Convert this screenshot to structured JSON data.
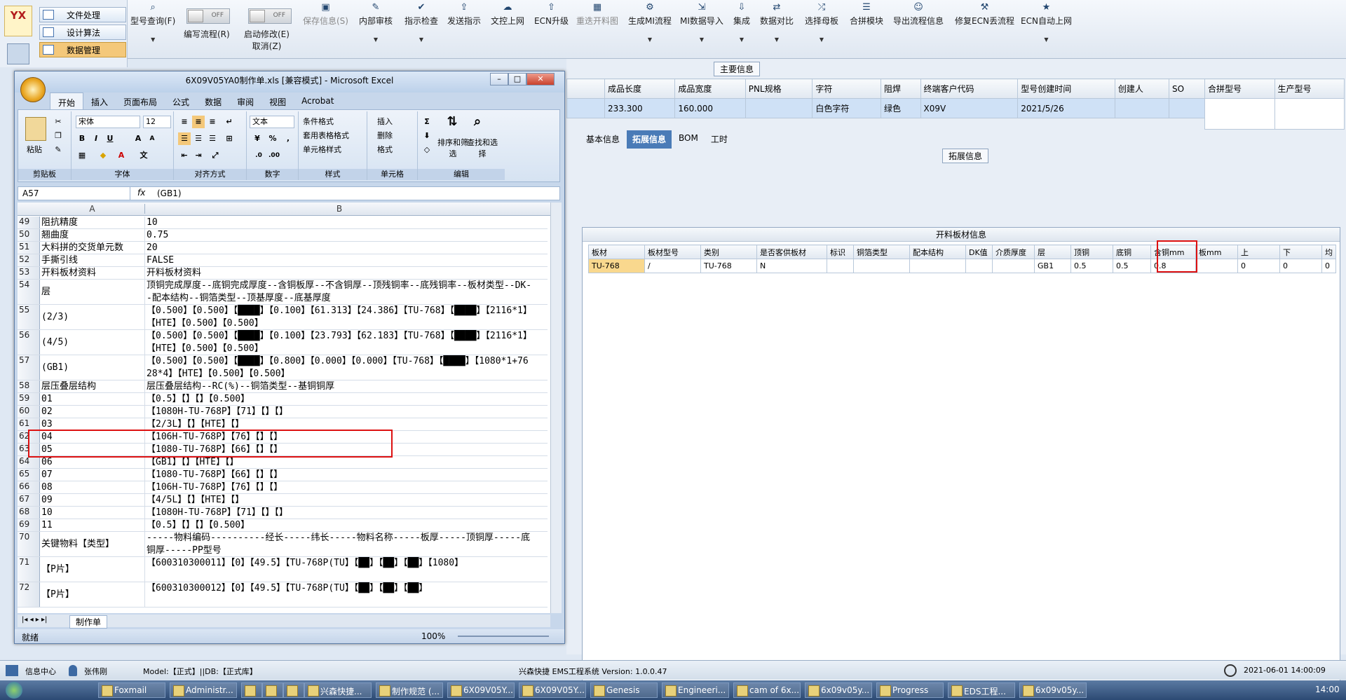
{
  "left_nav": {
    "logo": "YX",
    "items": [
      "文件处理",
      "设计算法",
      "数据管理"
    ]
  },
  "toolbar": {
    "buttons": [
      {
        "label": "型号查询(F)",
        "sub": "",
        "dis": false
      },
      {
        "label": "编写流程(R)",
        "sub": "",
        "dis": false
      },
      {
        "label": "启动修改(E)",
        "sub": "取消(Z)",
        "dis": false
      },
      {
        "label": "保存信息(S)",
        "sub": "",
        "dis": true
      },
      {
        "label": "内部审核",
        "sub": "",
        "dis": false
      },
      {
        "label": "指示检查",
        "sub": "",
        "dis": false
      },
      {
        "label": "发送指示",
        "sub": "",
        "dis": false
      },
      {
        "label": "文控上网",
        "sub": "",
        "dis": false
      },
      {
        "label": "ECN升级",
        "sub": "",
        "dis": false
      },
      {
        "label": "重迭开料图",
        "sub": "",
        "dis": true
      },
      {
        "label": "生成MI流程",
        "sub": "",
        "dis": false
      },
      {
        "label": "MI数据导入",
        "sub": "",
        "dis": false
      },
      {
        "label": "集成",
        "sub": "",
        "dis": false
      },
      {
        "label": "数据对比",
        "sub": "",
        "dis": false
      },
      {
        "label": "选择母板",
        "sub": "",
        "dis": false
      },
      {
        "label": "合拼模块",
        "sub": "",
        "dis": false
      },
      {
        "label": "导出流程信息",
        "sub": "",
        "dis": false
      },
      {
        "label": "修复ECN丢流程",
        "sub": "",
        "dis": false
      },
      {
        "label": "ECN自动上网",
        "sub": "",
        "dis": false
      }
    ],
    "toggle_off": "OFF"
  },
  "main": {
    "section_title": "主要信息",
    "headers": [
      "",
      "成品长度",
      "成品宽度",
      "PNL规格",
      "字符",
      "阻焊",
      "终端客户代码",
      "型号创建时间",
      "创建人",
      "SO"
    ],
    "row": [
      "",
      "233.300",
      "160.000",
      "",
      "白色字符",
      "绿色",
      "X09V",
      "2021/5/26",
      "",
      ""
    ],
    "side_headers": [
      "合拼型号",
      "生产型号"
    ],
    "tabs": [
      "基本信息",
      "拓展信息",
      "BOM",
      "工时"
    ],
    "ext_title": "拓展信息",
    "ext_sub": "开料板材信息",
    "ext_headers": [
      "板材",
      "板材型号",
      "类别",
      "是否客供板材",
      "标识",
      "铜箔类型",
      "配本结构",
      "DK值",
      "介质厚度",
      "层",
      "顶铜",
      "底铜",
      "含铜mm",
      "板mm",
      "上",
      "下",
      "均"
    ],
    "ext_row": [
      "TU-768",
      "/",
      "TU-768",
      "N",
      "",
      "",
      "",
      "",
      "",
      "GB1",
      "0.5",
      "0.5",
      "0.8",
      "",
      "0",
      "0",
      "0"
    ]
  },
  "excel": {
    "title": "6X09V05YA0制作单.xls  [兼容模式] - Microsoft Excel",
    "tabs": [
      "开始",
      "插入",
      "页面布局",
      "公式",
      "数据",
      "审阅",
      "视图",
      "Acrobat"
    ],
    "font": "宋体",
    "size": "12",
    "numfmt": "文本",
    "groups": [
      "剪贴板",
      "字体",
      "对齐方式",
      "数字",
      "样式",
      "单元格",
      "编辑"
    ],
    "style_btns": [
      "条件格式",
      "套用表格格式",
      "单元格样式"
    ],
    "cell_btns": [
      "插入",
      "删除",
      "格式"
    ],
    "edit_btns": [
      "排序和筛选",
      "查找和选择"
    ],
    "paste": "粘贴",
    "namebox": "A57",
    "formula": "(GB1)",
    "col_a": "A",
    "col_b": "B",
    "rows": [
      {
        "n": "49",
        "a": "阻抗精度",
        "b": "10",
        "h": 18
      },
      {
        "n": "50",
        "a": "翘曲度",
        "b": "0.75",
        "h": 18
      },
      {
        "n": "51",
        "a": "大料拼的交货单元数",
        "b": "20",
        "h": 18
      },
      {
        "n": "52",
        "a": "手撕引线",
        "b": "FALSE",
        "h": 18
      },
      {
        "n": "53",
        "a": "开料板材资料",
        "b": "开料板材资料",
        "h": 18
      },
      {
        "n": "54",
        "a": "层",
        "b": "顶铜完成厚度--底铜完成厚度--含铜板厚--不含铜厚--顶残铜率--底残铜率--板材类型--DK--配本结构--铜箔类型--顶基厚度--底基厚度",
        "h": 36
      },
      {
        "n": "55",
        "a": "(2/3)",
        "b": "【0.500】【0.500】【████】【0.100】【61.313】【24.386】【TU-768】【████】【2116*1】【HTE】【0.500】【0.500】",
        "h": 36
      },
      {
        "n": "56",
        "a": "(4/5)",
        "b": "【0.500】【0.500】【████】【0.100】【23.793】【62.183】【TU-768】【████】【2116*1】【HTE】【0.500】【0.500】",
        "h": 36
      },
      {
        "n": "57",
        "a": "(GB1)",
        "b": "【0.500】【0.500】【████】【0.800】【0.000】【0.000】【TU-768】【████】【1080*1+7628*4】【HTE】【0.500】【0.500】",
        "h": 36
      },
      {
        "n": "58",
        "a": "层压叠层结构",
        "b": "层压叠层结构--RC(%)--铜箔类型--基铜铜厚",
        "h": 18
      },
      {
        "n": "59",
        "a": "01",
        "b": "【0.5】【】【】【0.500】",
        "h": 18
      },
      {
        "n": "60",
        "a": "02",
        "b": "【1080H-TU-768P】【71】【】【】",
        "h": 18
      },
      {
        "n": "61",
        "a": "03",
        "b": "【2/3L】【】【HTE】【】",
        "h": 18
      },
      {
        "n": "62",
        "a": "04",
        "b": "【106H-TU-768P】【76】【】【】",
        "h": 18
      },
      {
        "n": "63",
        "a": "05",
        "b": "【1080-TU-768P】【66】【】【】",
        "h": 18
      },
      {
        "n": "64",
        "a": "06",
        "b": "【GB1】【】【HTE】【】",
        "h": 18
      },
      {
        "n": "65",
        "a": "07",
        "b": "【1080-TU-768P】【66】【】【】",
        "h": 18
      },
      {
        "n": "66",
        "a": "08",
        "b": "【106H-TU-768P】【76】【】【】",
        "h": 18
      },
      {
        "n": "67",
        "a": "09",
        "b": "【4/5L】【】【HTE】【】",
        "h": 18
      },
      {
        "n": "68",
        "a": "10",
        "b": "【1080H-TU-768P】【71】【】【】",
        "h": 18
      },
      {
        "n": "69",
        "a": "11",
        "b": "【0.5】【】【】【0.500】",
        "h": 18
      },
      {
        "n": "70",
        "a": "关键物料【类型】",
        "b": "-----物料编码----------经长-----纬长-----物料名称-----板厚-----顶铜厚-----底铜厚-----PP型号",
        "h": 36
      },
      {
        "n": "71",
        "a": "【P片】",
        "b": "【600310300011】【0】【49.5】【TU-768P(TU】【██】【██】【██】【1080】",
        "h": 36
      },
      {
        "n": "72",
        "a": "【P片】",
        "b": "【600310300012】【0】【49.5】【TU-768P(TU】【██】【██】【██】",
        "h": 36
      }
    ],
    "sheet_tab": "制作单",
    "status_ready": "就绪",
    "zoom": "100%"
  },
  "status": {
    "info": "信息中心",
    "user": "张伟刚",
    "model": "Model:【正式】||DB:【正式库】",
    "system": "兴森快捷 EMS工程系统 Version: 1.0.0.47",
    "datetime": "2021-06-01 14:00:09"
  },
  "taskbar": {
    "items": [
      "Foxmail",
      "Administr...",
      "",
      "",
      "",
      "兴森快捷...",
      "制作规范 (...",
      "6X09V05Y...",
      "6X09V05Y...",
      "Genesis",
      "Engineeri...",
      "cam of 6x...",
      "6x09v05y...",
      "Progress",
      "EDS工程...",
      "6x09v05y..."
    ],
    "clock": "14:00"
  }
}
